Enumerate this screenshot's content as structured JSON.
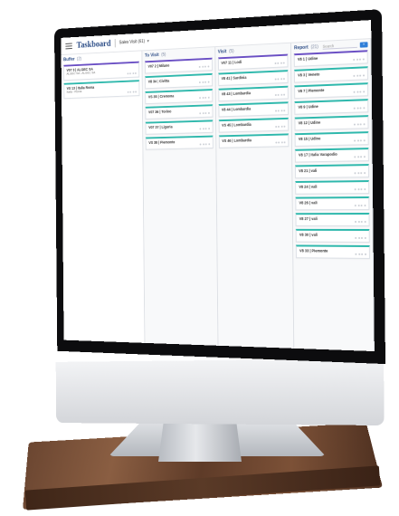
{
  "app": {
    "brand": "Taskboard",
    "board_selector": "Sales Visit (61)"
  },
  "columns": [
    {
      "title": "Buffer",
      "count": "(2)",
      "cards": [
        {
          "title": "V07 3 | ALGEC SA",
          "sub": "ALGEC SA - ALGEC SA",
          "accent": "purple"
        },
        {
          "title": "VS 13 | Italia Roma",
          "sub": "Italia - Roma",
          "accent": "teal"
        }
      ]
    },
    {
      "title": "To Visit",
      "count": "(5)",
      "cards": [
        {
          "title": "V07 2 | Milano",
          "sub": "",
          "accent": "purple"
        },
        {
          "title": "V8 34 | Civitta",
          "sub": "",
          "accent": "teal"
        },
        {
          "title": "VS 35 | Cremona",
          "sub": "",
          "accent": "teal"
        },
        {
          "title": "V07 36 | Torino",
          "sub": "",
          "accent": "teal"
        },
        {
          "title": "V07 37 | Liguria",
          "sub": "",
          "accent": "teal"
        },
        {
          "title": "VS 38 | Piemonte",
          "sub": "",
          "accent": "teal"
        }
      ]
    },
    {
      "title": "Visit",
      "count": "(5)",
      "cards": [
        {
          "title": "V07 11 | Lodi",
          "sub": "",
          "accent": "purple"
        },
        {
          "title": "V8 41 | Sardinia",
          "sub": "",
          "accent": "teal"
        },
        {
          "title": "V8 43 | Lombardia",
          "sub": "",
          "accent": "teal"
        },
        {
          "title": "V8 44 | Lombardia",
          "sub": "",
          "accent": "teal"
        },
        {
          "title": "VS 45 | Lombardia",
          "sub": "",
          "accent": "teal"
        },
        {
          "title": "VS 46 | Lombardia",
          "sub": "",
          "accent": "teal"
        }
      ]
    },
    {
      "title": "Report",
      "count": "(21)",
      "search_placeholder": "Search",
      "add_label": "+",
      "cards": [
        {
          "title": "V8 1 | Udine",
          "sub": "",
          "accent": "purple"
        },
        {
          "title": "V8 3 | Veneto",
          "sub": "",
          "accent": "teal"
        },
        {
          "title": "V8 7 | Piemonte",
          "sub": "",
          "accent": "teal"
        },
        {
          "title": "V8 9 | Udine",
          "sub": "",
          "accent": "teal"
        },
        {
          "title": "V8 12 | Udine",
          "sub": "",
          "accent": "teal"
        },
        {
          "title": "V8 15 | Udine",
          "sub": "",
          "accent": "teal"
        },
        {
          "title": "V8 17 | Italia Varapodio",
          "sub": "",
          "accent": "teal"
        },
        {
          "title": "V8 21 | vali",
          "sub": "",
          "accent": "teal"
        },
        {
          "title": "V8 24 | vali",
          "sub": "",
          "accent": "teal"
        },
        {
          "title": "V8 26 | vali",
          "sub": "",
          "accent": "teal"
        },
        {
          "title": "V8 27 | vali",
          "sub": "",
          "accent": "teal"
        },
        {
          "title": "V8 30 | vali",
          "sub": "",
          "accent": "teal"
        },
        {
          "title": "V8 33 | Piemonte",
          "sub": "",
          "accent": "teal"
        }
      ]
    }
  ]
}
